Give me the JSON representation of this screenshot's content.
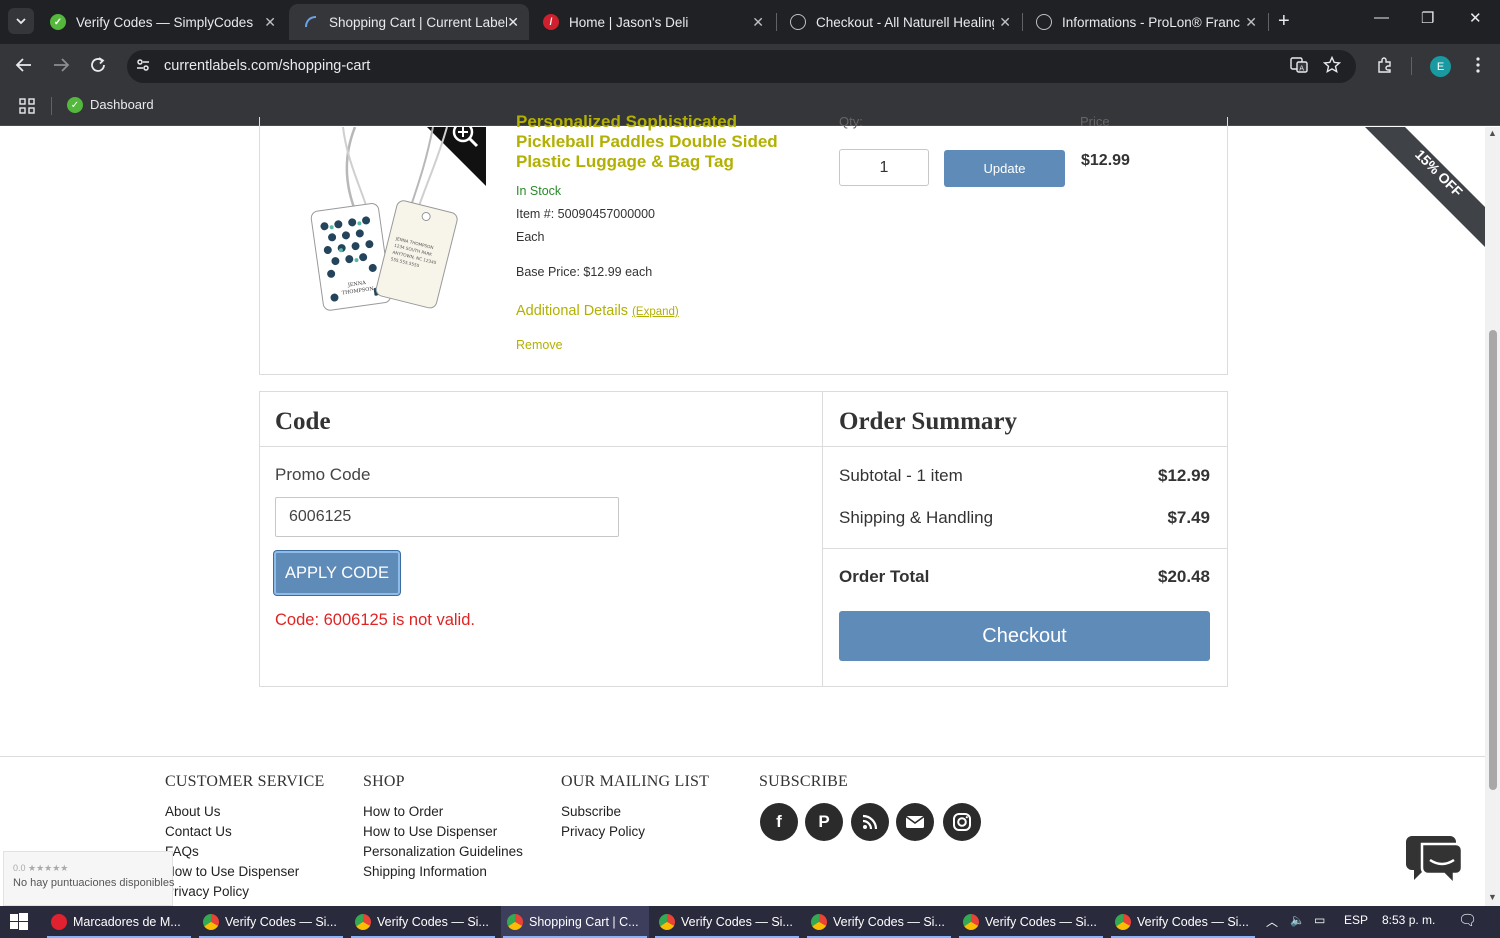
{
  "browser": {
    "tabs": [
      {
        "title": "Verify Codes — SimplyCodes",
        "active": false
      },
      {
        "title": "Shopping Cart | Current Labels",
        "active": true
      },
      {
        "title": "Home | Jason's Deli",
        "active": false
      },
      {
        "title": "Checkout - All Naturell Healing",
        "active": false
      },
      {
        "title": "Informations - ProLon® France",
        "active": false
      }
    ],
    "url": "currentlabels.com/shopping-cart",
    "profile_initial": "E",
    "bookmarks": [
      {
        "label": "Dashboard"
      }
    ]
  },
  "product": {
    "title": "Personalized Sophisticated Pickleball Paddles Double Sided Plastic Luggage & Bag Tag",
    "stock": "In Stock",
    "item_number": "Item #: 50090457000000",
    "unit": "Each",
    "base_price": "Base Price: $12.99 each",
    "additional_details": "Additional Details",
    "expand": "(Expand)",
    "remove": "Remove",
    "qty_label": "Qty:",
    "price_label": "Price",
    "qty": "1",
    "update": "Update",
    "price": "$12.99",
    "ribbon": "15% OFF",
    "tag_name": "JENNA THOMPSON"
  },
  "code": {
    "title": "Code",
    "promo_label": "Promo Code",
    "promo_value": "6006125",
    "apply": "APPLY CODE",
    "error": "Code: 6006125 is not valid."
  },
  "summary": {
    "title": "Order Summary",
    "subtotal_label": "Subtotal - 1 item",
    "subtotal": "$12.99",
    "shipping_label": "Shipping & Handling",
    "shipping": "$7.49",
    "total_label": "Order Total",
    "total": "$20.48",
    "checkout": "Checkout"
  },
  "footer": {
    "customer_service": {
      "title": "CUSTOMER SERVICE",
      "links": [
        "About Us",
        "Contact Us",
        "FAQs",
        "How to Use Dispenser",
        "Privacy Policy"
      ]
    },
    "shop": {
      "title": "SHOP",
      "links": [
        "How to Order",
        "How to Use Dispenser",
        "Personalization Guidelines",
        "Shipping Information"
      ]
    },
    "mailing": {
      "title": "OUR MAILING LIST",
      "links": [
        "Subscribe",
        "Privacy Policy"
      ]
    },
    "subscribe": {
      "title": "SUBSCRIBE"
    }
  },
  "rating_widget": {
    "stars": "0.0 ★★★★★",
    "text": "No hay puntuaciones disponibles"
  },
  "taskbar": {
    "items": [
      "Marcadores de M...",
      "Verify Codes — Si...",
      "Verify Codes — Si...",
      "Shopping Cart | C...",
      "Verify Codes — Si...",
      "Verify Codes — Si...",
      "Verify Codes — Si...",
      "Verify Codes — Si..."
    ],
    "language": "ESP",
    "time": "8:53 p. m."
  },
  "colors": {
    "accent": "#5f8bb8",
    "link": "#b2b000",
    "error": "#e02424",
    "stock": "#2a8a2a"
  }
}
